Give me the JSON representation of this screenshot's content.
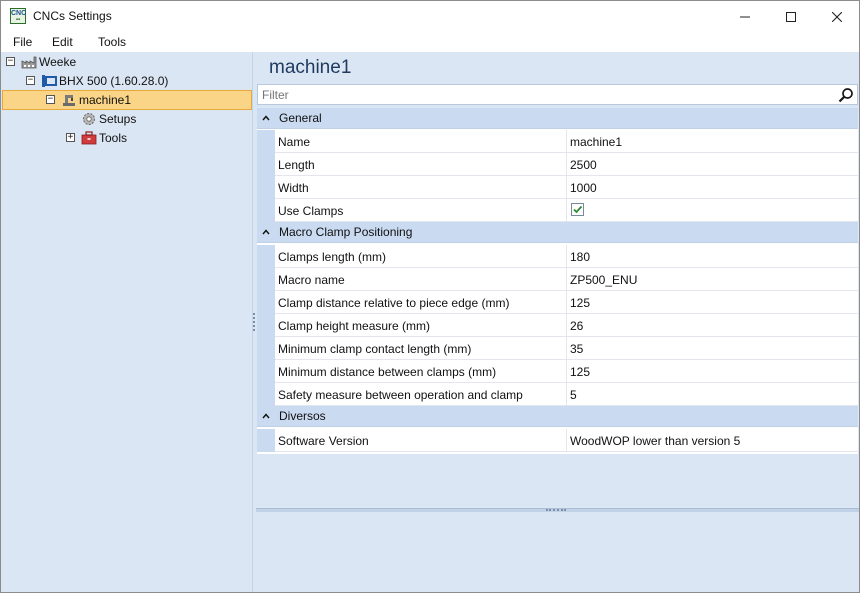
{
  "window": {
    "title": "CNCs Settings"
  },
  "menu": [
    "File",
    "Edit",
    "Tools"
  ],
  "tree": {
    "root": {
      "label": "Weeke",
      "expander": "−"
    },
    "machine_type": {
      "label": "BHX 500 (1.60.28.0)",
      "expander": "−"
    },
    "machine": {
      "label": "machine1",
      "expander": "−"
    },
    "setups": {
      "label": "Setups"
    },
    "tools": {
      "label": "Tools",
      "expander": "+"
    }
  },
  "panel": {
    "heading": "machine1",
    "filter_placeholder": "Filter"
  },
  "grid": {
    "general": {
      "label": "General",
      "rows": [
        {
          "name": "Name",
          "value": "machine1"
        },
        {
          "name": "Length",
          "value": "2500"
        },
        {
          "name": "Width",
          "value": "1000"
        },
        {
          "name": "Use Clamps",
          "checked": true
        }
      ]
    },
    "macro": {
      "label": "Macro Clamp Positioning",
      "rows": [
        {
          "name": "Clamps length (mm)",
          "value": "180"
        },
        {
          "name": "Macro name",
          "value": "ZP500_ENU"
        },
        {
          "name": "Clamp distance relative to piece edge (mm)",
          "value": "125"
        },
        {
          "name": "Clamp height measure (mm)",
          "value": "26"
        },
        {
          "name": "Minimum clamp contact length (mm)",
          "value": "35"
        },
        {
          "name": "Minimum distance between clamps (mm)",
          "value": "125"
        },
        {
          "name": "Safety measure between operation and clamp",
          "value": "5"
        }
      ]
    },
    "diversos": {
      "label": "Diversos",
      "rows": [
        {
          "name": "Software Version",
          "value": "WoodWOP lower than version 5"
        }
      ]
    }
  },
  "colors": {
    "selection_fill": "#fbd587",
    "category_fill": "#c9daf1",
    "pane_background": "#dbe6f4",
    "checkmark": "#2e8b2e"
  },
  "icons": [
    "factory-icon",
    "machine-type-icon",
    "machine-icon",
    "gear-icon",
    "toolbox-icon",
    "search-icon",
    "minimize-icon",
    "maximize-icon",
    "close-icon",
    "collapse-caret-icon"
  ]
}
